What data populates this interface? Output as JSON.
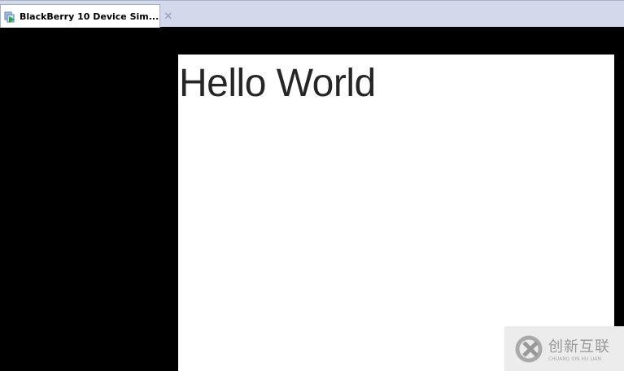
{
  "tab": {
    "title": "BlackBerry 10 Device Sim...",
    "close_icon": "close-icon"
  },
  "app": {
    "heading": "Hello World"
  },
  "watermark": {
    "cn": "创新互联",
    "en": "CHUANG XIN HU LIAN"
  }
}
